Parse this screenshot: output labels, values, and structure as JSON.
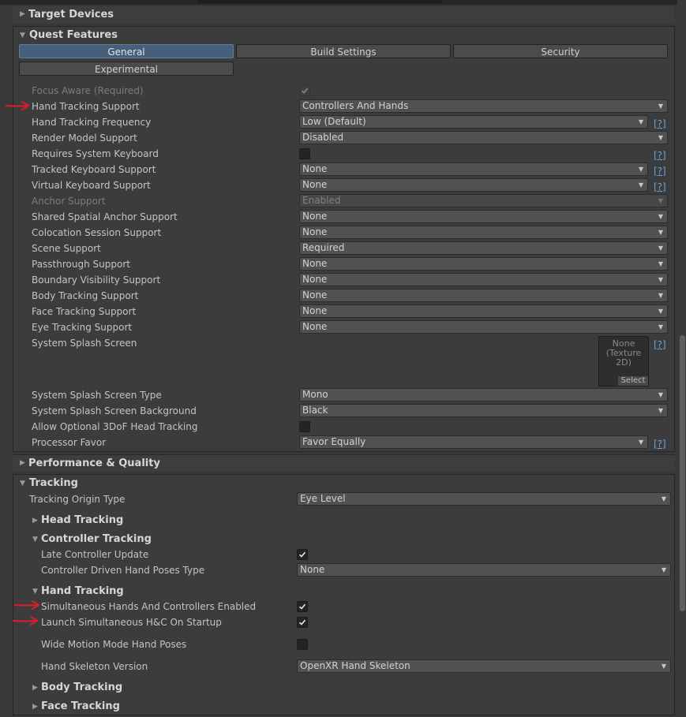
{
  "sections": {
    "target_devices": "Target Devices",
    "quest_features": "Quest Features",
    "performance": "Performance & Quality",
    "tracking": "Tracking"
  },
  "tabs": [
    "General",
    "Build Settings",
    "Security",
    "Experimental"
  ],
  "general": {
    "focus_aware": "Focus Aware (Required)",
    "hand_tracking_support": {
      "label": "Hand Tracking Support",
      "value": "Controllers And Hands"
    },
    "hand_tracking_frequency": {
      "label": "Hand Tracking Frequency",
      "value": "Low (Default)"
    },
    "render_model_support": {
      "label": "Render Model Support",
      "value": "Disabled"
    },
    "requires_system_keyboard": {
      "label": "Requires System Keyboard"
    },
    "tracked_keyboard_support": {
      "label": "Tracked Keyboard Support",
      "value": "None"
    },
    "virtual_keyboard_support": {
      "label": "Virtual Keyboard Support",
      "value": "None"
    },
    "anchor_support": {
      "label": "Anchor Support",
      "value": "Enabled"
    },
    "shared_spatial_anchor": {
      "label": "Shared Spatial Anchor Support",
      "value": "None"
    },
    "colocation_session": {
      "label": "Colocation Session Support",
      "value": "None"
    },
    "scene_support": {
      "label": "Scene Support",
      "value": "Required"
    },
    "passthrough_support": {
      "label": "Passthrough Support",
      "value": "None"
    },
    "boundary_visibility": {
      "label": "Boundary Visibility Support",
      "value": "None"
    },
    "body_tracking": {
      "label": "Body Tracking Support",
      "value": "None"
    },
    "face_tracking": {
      "label": "Face Tracking Support",
      "value": "None"
    },
    "eye_tracking": {
      "label": "Eye Tracking Support",
      "value": "None"
    },
    "splash_screen": {
      "label": "System Splash Screen",
      "texture_line1": "None",
      "texture_line2": "(Texture",
      "texture_line3": "2D)",
      "select": "Select"
    },
    "splash_screen_type": {
      "label": "System Splash Screen Type",
      "value": "Mono"
    },
    "splash_screen_background": {
      "label": "System Splash Screen Background",
      "value": "Black"
    },
    "optional_3dof": {
      "label": "Allow Optional 3DoF Head Tracking"
    },
    "processor_favor": {
      "label": "Processor Favor",
      "value": "Favor Equally"
    },
    "help": "[?]"
  },
  "tracking": {
    "origin_type": {
      "label": "Tracking Origin Type",
      "value": "Eye Level"
    },
    "head_tracking": "Head Tracking",
    "controller_tracking": "Controller Tracking",
    "late_controller_update": "Late Controller Update",
    "controller_driven_hand_poses": {
      "label": "Controller Driven Hand Poses Type",
      "value": "None"
    },
    "hand_tracking": "Hand Tracking",
    "simultaneous_enabled": "Simultaneous Hands And Controllers Enabled",
    "launch_simultaneous": "Launch Simultaneous H&C On Startup",
    "wide_motion": "Wide Motion Mode Hand Poses",
    "hand_skeleton": {
      "label": "Hand Skeleton Version",
      "value": "OpenXR Hand Skeleton"
    },
    "body_tracking": "Body Tracking",
    "face_tracking": "Face Tracking"
  },
  "colors": {
    "accent_tab": "#46607c",
    "help_link": "#6d9fe0",
    "annotation_arrow": "#d0202a"
  }
}
